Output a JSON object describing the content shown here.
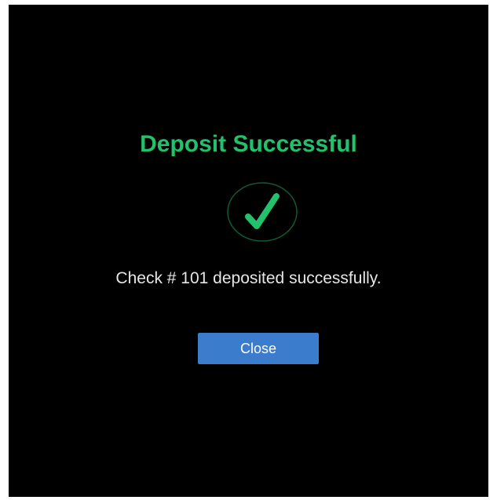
{
  "dialog": {
    "title": "Deposit Successful",
    "message": "Check # 101 deposited successfully.",
    "close_label": "Close",
    "icon": "checkmark-icon"
  },
  "colors": {
    "background": "#000000",
    "title": "#21c26b",
    "check": "#21c26b",
    "message": "#e6e6e6",
    "button": "#3b7ccc",
    "button_text": "#ffffff"
  }
}
